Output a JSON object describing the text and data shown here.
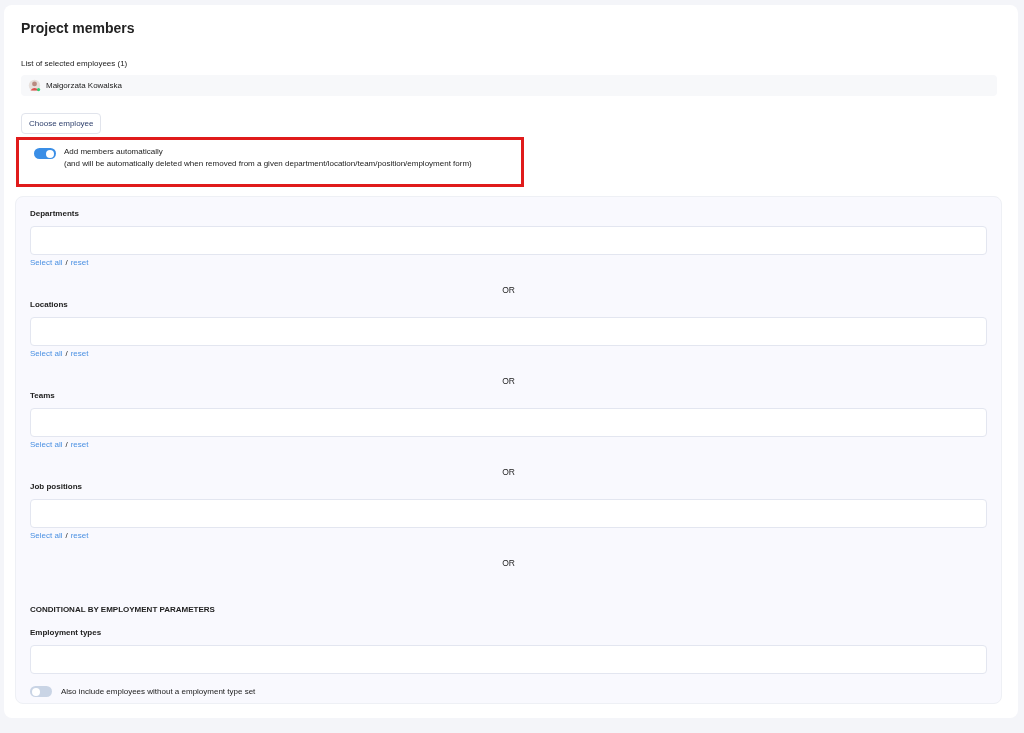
{
  "title": "Project members",
  "selected_list": {
    "label": "List of selected employees (1)",
    "employees": [
      {
        "name": "Małgorzata Kowalska",
        "online": true
      }
    ]
  },
  "choose_button": "Choose employee",
  "auto_toggle": {
    "on": true,
    "label": "Add members automatically",
    "note": "(and will be automatically deleted when removed from a given department/location/team/position/employment form)",
    "highlighted": true
  },
  "filters": [
    {
      "label": "Departments",
      "select_all": "Select all",
      "separator": "/",
      "reset": "reset",
      "or": "OR"
    },
    {
      "label": "Locations",
      "select_all": "Select all",
      "separator": "/",
      "reset": "reset",
      "or": "OR"
    },
    {
      "label": "Teams",
      "select_all": "Select all",
      "separator": "/",
      "reset": "reset",
      "or": "OR"
    },
    {
      "label": "Job positions",
      "select_all": "Select all",
      "separator": "/",
      "reset": "reset",
      "or": "OR"
    }
  ],
  "conditional": {
    "heading": "CONDITIONAL BY EMPLOYMENT PARAMETERS",
    "field_label": "Employment types",
    "toggle": {
      "on": false,
      "label": "Also include employees without a employment type set"
    }
  }
}
